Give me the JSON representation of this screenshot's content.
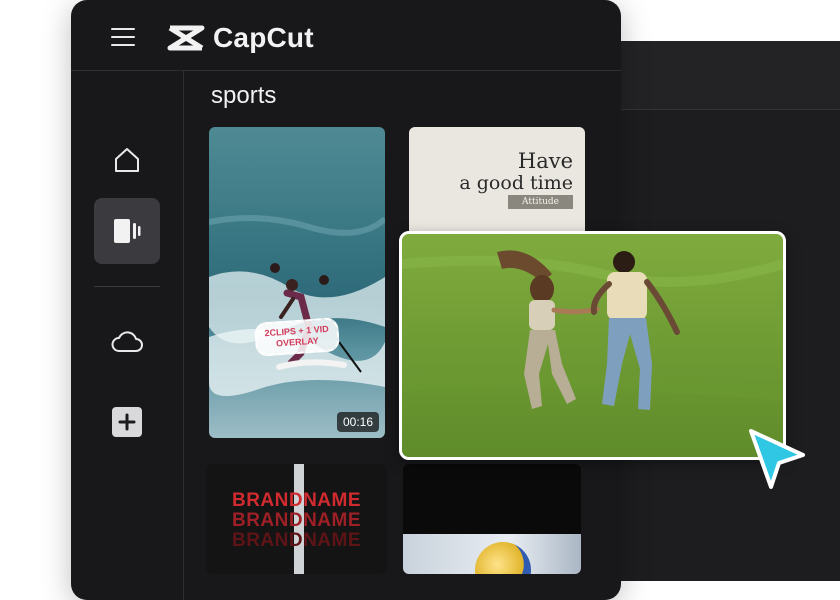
{
  "app": {
    "name": "CapCut"
  },
  "section": {
    "title": "sports"
  },
  "sidebar": {
    "items": [
      "home",
      "templates",
      "cloud",
      "add"
    ]
  },
  "cards": [
    {
      "duration": "00:16",
      "overlay_line1": "2CLIPS + 1 VID",
      "overlay_line2": "OVERLAY"
    },
    {
      "line1": "Have",
      "line2": "a good time",
      "badge": "Attitude"
    },
    {
      "brand1": "BRANDNAME",
      "brand2": "BRANDNAME",
      "brand3": "BRANDNAME"
    }
  ],
  "colors": {
    "app_bg": "#18181b",
    "active_nav": "#3a3a3f",
    "cursor": "#2fc7e3",
    "brand_red": "#c8232c"
  }
}
